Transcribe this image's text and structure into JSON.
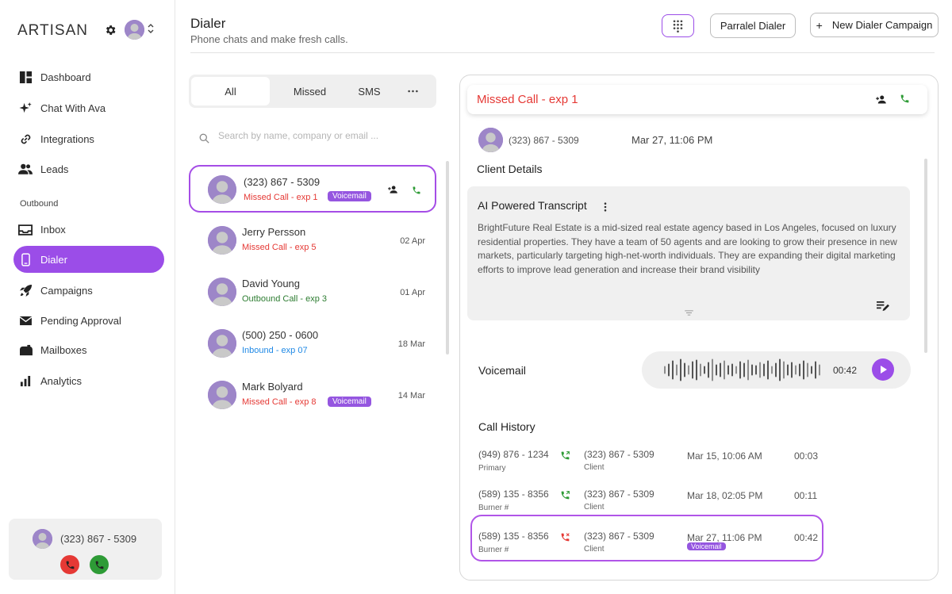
{
  "sidebar": {
    "brand": "ARTISAN",
    "nav": [
      {
        "label": "Dashboard",
        "icon": "dashboard-icon"
      },
      {
        "label": "Chat With Ava",
        "icon": "sparkle-icon"
      },
      {
        "label": "Integrations",
        "icon": "link-icon"
      },
      {
        "label": "Leads",
        "icon": "people-icon"
      }
    ],
    "section_label": "Outbound",
    "outbound_nav": [
      {
        "label": "Inbox",
        "icon": "inbox-icon"
      },
      {
        "label": "Dialer",
        "icon": "phone-device-icon",
        "active": true
      },
      {
        "label": "Campaigns",
        "icon": "rocket-icon"
      },
      {
        "label": "Pending Approval",
        "icon": "mail-icon"
      },
      {
        "label": "Mailboxes",
        "icon": "mailbox-icon"
      },
      {
        "label": "Analytics",
        "icon": "bar-chart-icon"
      }
    ],
    "call_widget": {
      "number": "(323) 867 - 5309"
    }
  },
  "header": {
    "title": "Dialer",
    "subtitle": "Phone chats and make fresh calls.",
    "parallel_label": "Parralel Dialer",
    "new_campaign_label": "New Dialer Campaign",
    "new_campaign_plus": "+"
  },
  "tabs": {
    "all": "All",
    "missed": "Missed",
    "sms": "SMS"
  },
  "search": {
    "placeholder": "Search by name, company or email ..."
  },
  "conversations": [
    {
      "name": "(323) 867 - 5309",
      "status": "Missed Call - exp 1",
      "badge": "Voicemail",
      "date": ""
    },
    {
      "name": "Jerry Persson",
      "status": "Missed Call - exp 5",
      "badge": "",
      "date": "02 Apr"
    },
    {
      "name": "David Young",
      "status": "Outbound Call - exp 3",
      "badge": "",
      "date": "01 Apr"
    },
    {
      "name": "(500) 250 - 0600",
      "status": "Inbound - exp 07",
      "badge": "",
      "date": "18 Mar"
    },
    {
      "name": "Mark Bolyard",
      "status": "Missed Call - exp 8",
      "badge": "Voicemail",
      "date": "14 Mar"
    }
  ],
  "detail": {
    "title": "Missed Call - exp 1",
    "caller_number": "(323) 867 - 5309",
    "caller_time": "Mar 27, 11:06 PM",
    "client_details_label": "Client Details",
    "transcript_title": "AI Powered Transcript",
    "transcript_text": "BrightFuture Real Estate is a mid-sized real estate agency based in Los Angeles, focused on luxury residential properties. They have a team of 50 agents and are looking to grow their presence in new markets, particularly targeting high-net-worth individuals. They are expanding their digital marketing efforts to improve lead generation and increase their brand visibility",
    "voicemail_label": "Voicemail",
    "voicemail_duration": "00:42",
    "call_history_label": "Call History",
    "history": [
      {
        "from": "(949) 876 - 1234",
        "from_label": "Primary",
        "to": "(323) 867 - 5309",
        "to_label": "Client",
        "time": "Mar 15, 10:06 AM",
        "duration": "00:03",
        "badge": ""
      },
      {
        "from": "(589) 135 - 8356",
        "from_label": "Burner #",
        "to": "(323) 867 - 5309",
        "to_label": "Client",
        "time": "Mar 18, 02:05 PM",
        "duration": "00:11",
        "badge": ""
      },
      {
        "from": "(589) 135 - 8356",
        "from_label": "Burner #",
        "to": "(323) 867 - 5309",
        "to_label": "Client",
        "time": "Mar 27, 11:06 PM",
        "duration": "00:42",
        "badge": "Voicemail"
      }
    ]
  },
  "colors": {
    "accent": "#9b4de8",
    "missed": "#e53935",
    "outbound": "#2e7d32",
    "inbound": "#1e88e5"
  }
}
